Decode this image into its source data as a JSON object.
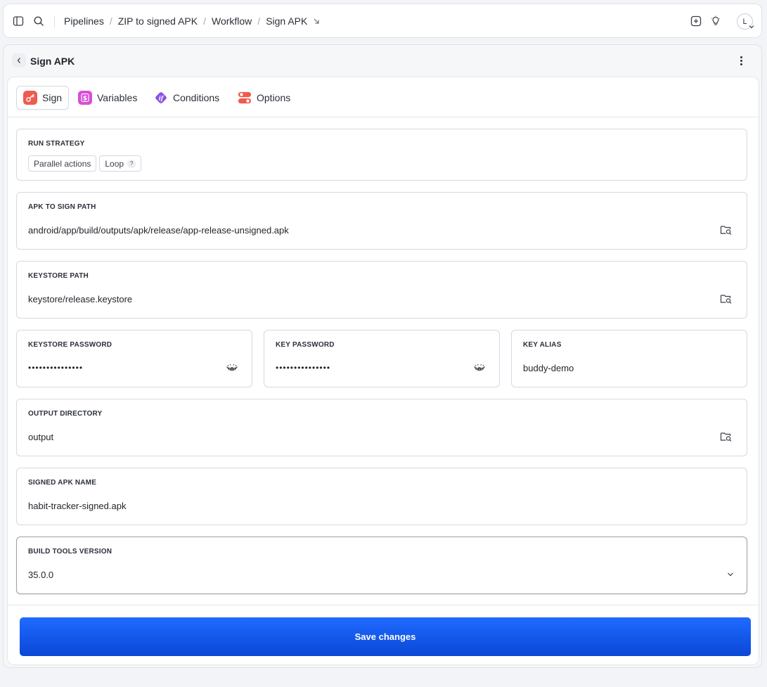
{
  "breadcrumbs": [
    "Pipelines",
    "ZIP to signed APK",
    "Workflow",
    "Sign APK"
  ],
  "user": {
    "initial": "L"
  },
  "panel": {
    "title": "Sign APK"
  },
  "tabs": [
    {
      "label": "Sign",
      "icon": "key-icon",
      "color": "#ef5b4c",
      "active": true
    },
    {
      "label": "Variables",
      "icon": "dollar-icon",
      "color": "#d64fd8"
    },
    {
      "label": "Conditions",
      "icon": "if-icon",
      "color": "#8a52e6"
    },
    {
      "label": "Options",
      "icon": "toggles-icon",
      "color": "#ef5b4c"
    }
  ],
  "run_strategy": {
    "label": "RUN STRATEGY",
    "options": [
      "Parallel actions",
      "Loop"
    ],
    "help": "?"
  },
  "fields": {
    "apk_path": {
      "label": "APK TO SIGN PATH",
      "value": "android/app/build/outputs/apk/release/app-release-unsigned.apk"
    },
    "keystore_path": {
      "label": "KEYSTORE PATH",
      "value": "keystore/release.keystore"
    },
    "keystore_password": {
      "label": "KEYSTORE PASSWORD",
      "value": "•••••••••••••••"
    },
    "key_password": {
      "label": "KEY PASSWORD",
      "value": "•••••••••••••••"
    },
    "key_alias": {
      "label": "KEY ALIAS",
      "value": "buddy-demo"
    },
    "output_directory": {
      "label": "OUTPUT DIRECTORY",
      "value": "output"
    },
    "signed_apk_name": {
      "label": "SIGNED APK NAME",
      "value": "habit-tracker-signed.apk"
    },
    "build_tools_version": {
      "label": "BUILD TOOLS VERSION",
      "value": "35.0.0"
    }
  },
  "save_button": "Save changes",
  "colors": {
    "primary": "#1559f0",
    "border": "#d5d9df"
  }
}
